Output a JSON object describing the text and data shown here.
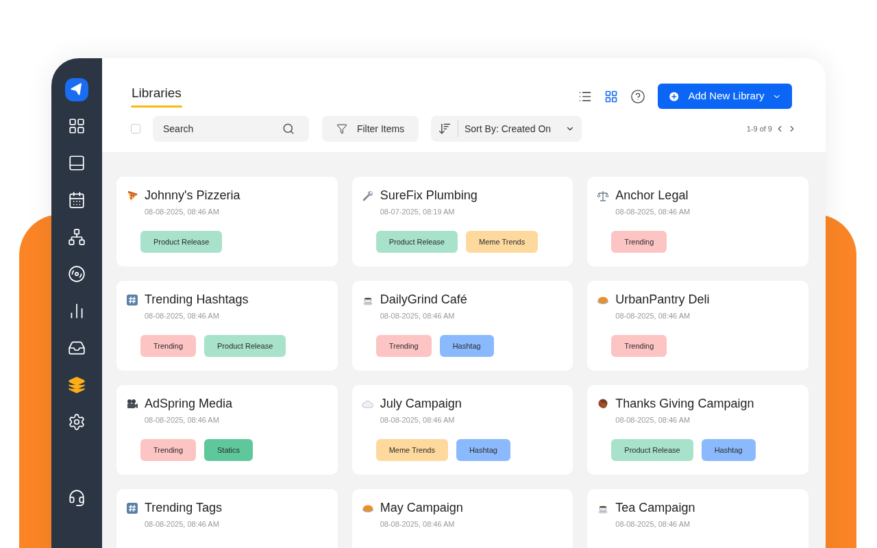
{
  "sidebar": {
    "items": [
      {
        "kind": "dashboard",
        "selected": false
      },
      {
        "kind": "panel",
        "selected": false
      },
      {
        "kind": "calendar",
        "selected": false
      },
      {
        "kind": "network",
        "selected": false
      },
      {
        "kind": "circle-dots",
        "selected": false
      },
      {
        "kind": "chart",
        "selected": false
      },
      {
        "kind": "inbox",
        "selected": false
      },
      {
        "kind": "layers",
        "selected": true
      },
      {
        "kind": "settings",
        "selected": false
      }
    ]
  },
  "header": {
    "title": "Libraries",
    "add_button": "Add New Library",
    "view": {
      "list_selected": false,
      "grid_selected": true
    }
  },
  "toolbar": {
    "search": {
      "placeholder": "Search"
    },
    "select_all": {
      "checked": false
    },
    "filter": "Filter Items",
    "sort": "Sort By: Created On",
    "pagination": "1-9 of 9"
  },
  "libraries": [
    {
      "kind": "pizza",
      "name": "Johnny's Pizzeria",
      "date": "08-08-2025, 08:46 AM",
      "tags": [
        {
          "label": "Product Release",
          "color": "#a8e2cb"
        }
      ]
    },
    {
      "kind": "wrench",
      "name": "SureFix Plumbing",
      "date": "08-07-2025, 08:19 AM",
      "tags": [
        {
          "label": "Product Release",
          "color": "#a8e2cb"
        },
        {
          "label": "Meme Trends",
          "color": "#fdd99e"
        }
      ]
    },
    {
      "kind": "scales",
      "name": "Anchor Legal",
      "date": "08-08-2025, 08:46 AM",
      "tags": [
        {
          "label": "Trending",
          "color": "#fdc4c4"
        }
      ]
    },
    {
      "kind": "hash",
      "name": "Trending Hashtags",
      "date": "08-08-2025, 08:46 AM",
      "tags": [
        {
          "label": "Trending",
          "color": "#fdc4c4"
        },
        {
          "label": "Product Release",
          "color": "#a8e2cb"
        }
      ]
    },
    {
      "kind": "coffee",
      "name": "DailyGrind Café",
      "date": "08-08-2025, 08:46 AM",
      "tags": [
        {
          "label": "Trending",
          "color": "#fdc4c4"
        },
        {
          "label": "Hashtag",
          "color": "#8bb9fe"
        }
      ]
    },
    {
      "kind": "pie",
      "name": "UrbanPantry Deli",
      "date": "08-08-2025, 08:46 AM",
      "tags": [
        {
          "label": "Trending",
          "color": "#fdc4c4"
        }
      ]
    },
    {
      "kind": "camera",
      "name": "AdSpring Media",
      "date": "08-08-2025, 08:46 AM",
      "tags": [
        {
          "label": "Trending",
          "color": "#fdc4c4"
        },
        {
          "label": "Statics",
          "color": "#5ec89c"
        }
      ]
    },
    {
      "kind": "cloud",
      "name": "July Campaign",
      "date": "08-08-2025, 08:46 AM",
      "tags": [
        {
          "label": "Meme Trends",
          "color": "#fdd99e"
        },
        {
          "label": "Hashtag",
          "color": "#8bb9fe"
        }
      ]
    },
    {
      "kind": "turkey",
      "name": "Thanks Giving Campaign",
      "date": "08-08-2025, 08:46 AM",
      "tags": [
        {
          "label": "Product Release",
          "color": "#a8e2cb"
        },
        {
          "label": "Hashtag",
          "color": "#8bb9fe"
        }
      ]
    },
    {
      "kind": "hash",
      "name": "Trending Tags",
      "date": "08-08-2025, 08:46 AM"
    },
    {
      "kind": "pie",
      "name": "May Campaign",
      "date": "08-08-2025, 08:46 AM"
    },
    {
      "kind": "coffee",
      "name": "Tea Campaign",
      "date": "08-08-2025, 08:46 AM"
    }
  ]
}
